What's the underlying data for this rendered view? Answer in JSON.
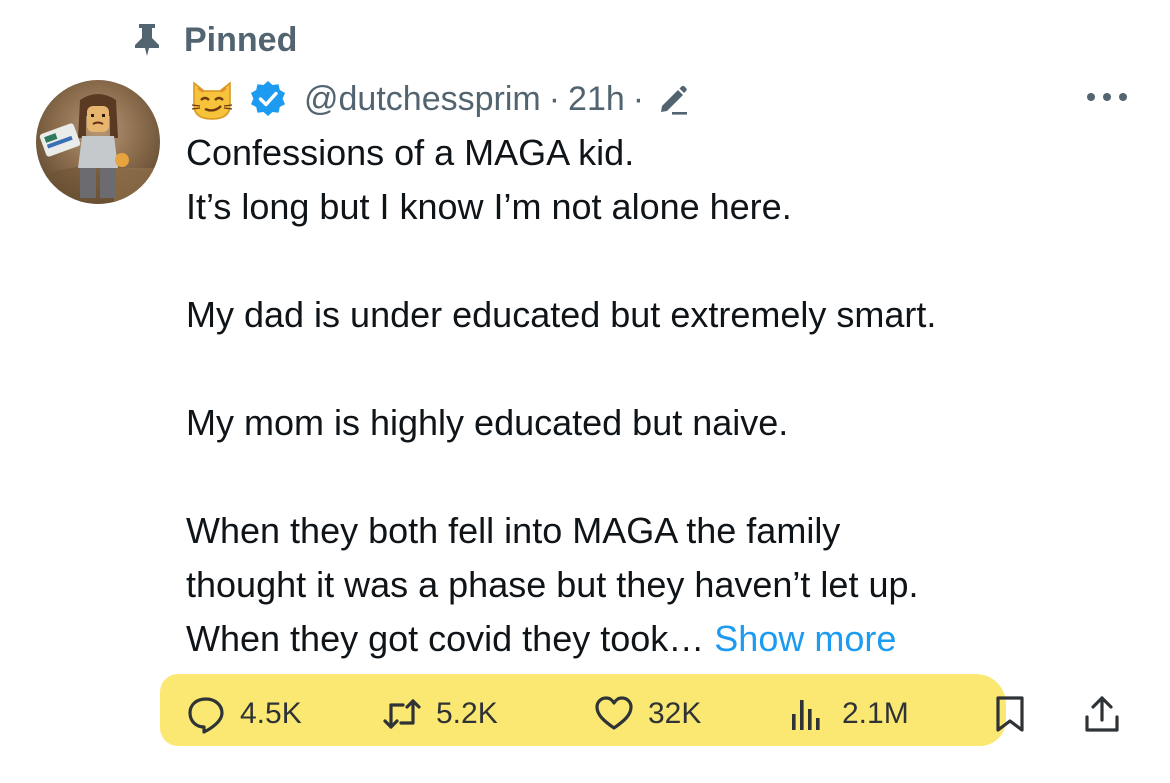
{
  "pinned": {
    "label": "Pinned",
    "icon": "pin-icon"
  },
  "author": {
    "emoji": "cat-smirk-emoji",
    "verified_icon": "verified-badge-icon",
    "handle": "@dutchessprim",
    "separator": "·",
    "time": "21h",
    "edited_icon": "edit-pencil-icon"
  },
  "more_icon": "more-options-icon",
  "tweet": {
    "lines": [
      "Confessions of a MAGA kid.",
      "It’s long but I know I’m not alone here.",
      "My dad is under educated but extremely smart.",
      "My mom is highly educated but naive.",
      "When they both fell into MAGA the family",
      "thought it was a phase but they haven’t let up.",
      "When they got covid they took…"
    ],
    "show_more": "Show more"
  },
  "actions": {
    "replies": "4.5K",
    "reposts": "5.2K",
    "likes": "32K",
    "views": "2.1M"
  },
  "colors": {
    "accent": "#1d9bf0",
    "text": "#0f1419",
    "muted": "#536471",
    "highlight": "#fbe55e"
  }
}
